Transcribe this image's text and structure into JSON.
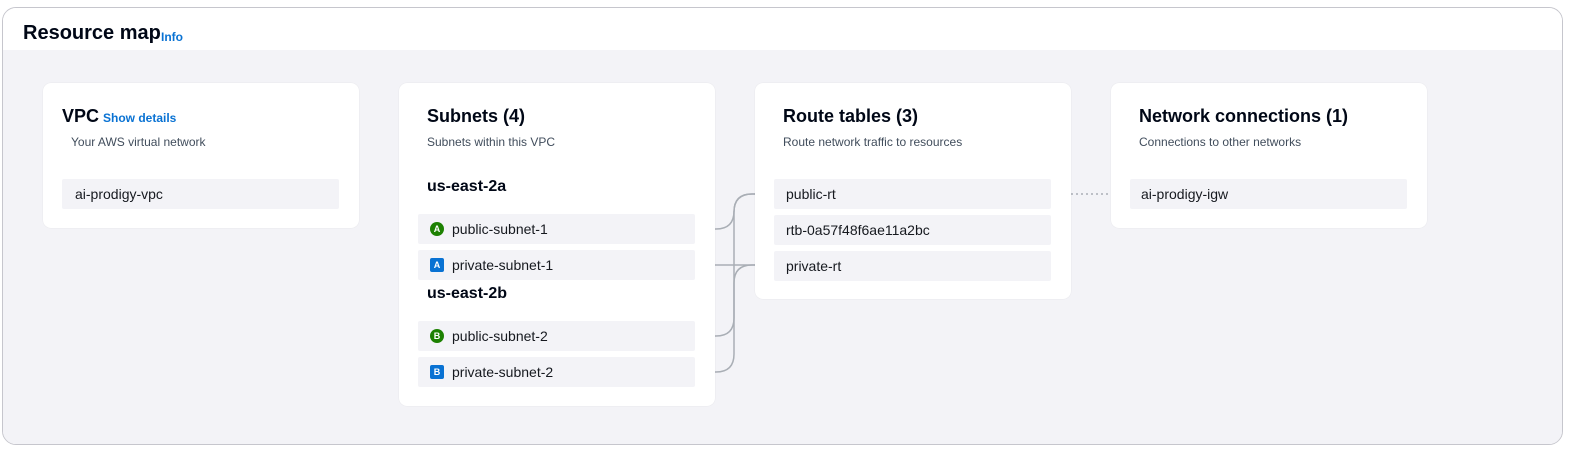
{
  "header": {
    "title": "Resource map",
    "info_label": "Info"
  },
  "vpc": {
    "title": "VPC",
    "show_details_label": "Show details",
    "description": "Your AWS virtual network",
    "name": "ai-prodigy-vpc"
  },
  "subnets": {
    "title": "Subnets (4)",
    "description": "Subnets within this VPC",
    "zones": [
      {
        "name": "us-east-2a",
        "items": [
          {
            "badge": "A",
            "badge_style": "public",
            "name": "public-subnet-1"
          },
          {
            "badge": "A",
            "badge_style": "private",
            "name": "private-subnet-1"
          }
        ]
      },
      {
        "name": "us-east-2b",
        "items": [
          {
            "badge": "B",
            "badge_style": "public",
            "name": "public-subnet-2"
          },
          {
            "badge": "B",
            "badge_style": "private",
            "name": "private-subnet-2"
          }
        ]
      }
    ]
  },
  "route_tables": {
    "title": "Route tables (3)",
    "description": "Route network traffic to resources",
    "items": [
      "public-rt",
      "rtb-0a57f48f6ae11a2bc",
      "private-rt"
    ]
  },
  "network_connections": {
    "title": "Network connections (1)",
    "description": "Connections to other networks",
    "items": [
      "ai-prodigy-igw"
    ]
  },
  "colors": {
    "public_badge": "#1d8102",
    "private_badge": "#0972d3",
    "link": "#0972d3",
    "connector": "#a9aeb5",
    "canvas_bg": "#f3f3f7"
  }
}
